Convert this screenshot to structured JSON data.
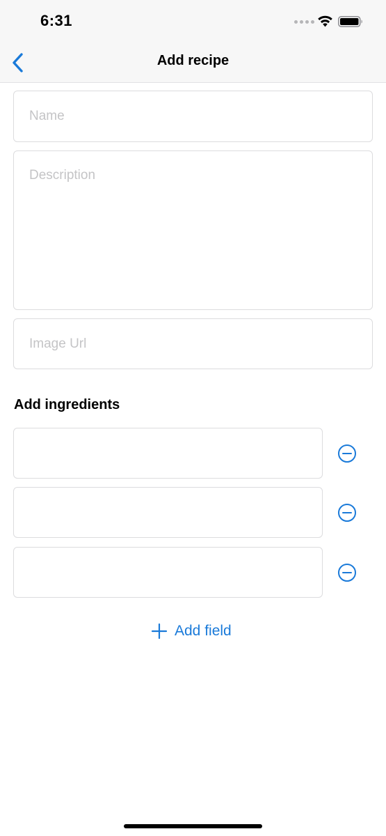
{
  "status_bar": {
    "time": "6:31",
    "icons": [
      "signal-dots-icon",
      "wifi-icon",
      "battery-icon"
    ]
  },
  "nav": {
    "back_icon": "chevron-left-icon",
    "title": "Add recipe"
  },
  "form": {
    "name": {
      "placeholder": "Name",
      "value": ""
    },
    "description": {
      "placeholder": "Description",
      "value": ""
    },
    "image_url": {
      "placeholder": "Image Url",
      "value": ""
    }
  },
  "ingredients": {
    "label": "Add ingredients",
    "fields": [
      {
        "value": "",
        "remove_icon": "minus-circle-icon"
      },
      {
        "value": "",
        "remove_icon": "minus-circle-icon"
      },
      {
        "value": "",
        "remove_icon": "minus-circle-icon"
      }
    ],
    "add_button": {
      "icon": "plus-icon",
      "label": "Add field"
    }
  },
  "colors": {
    "accent": "#1a7ad9",
    "placeholder": "#c4c4c6",
    "field_border": "#dcdcde",
    "nav_background": "#f7f7f7"
  }
}
